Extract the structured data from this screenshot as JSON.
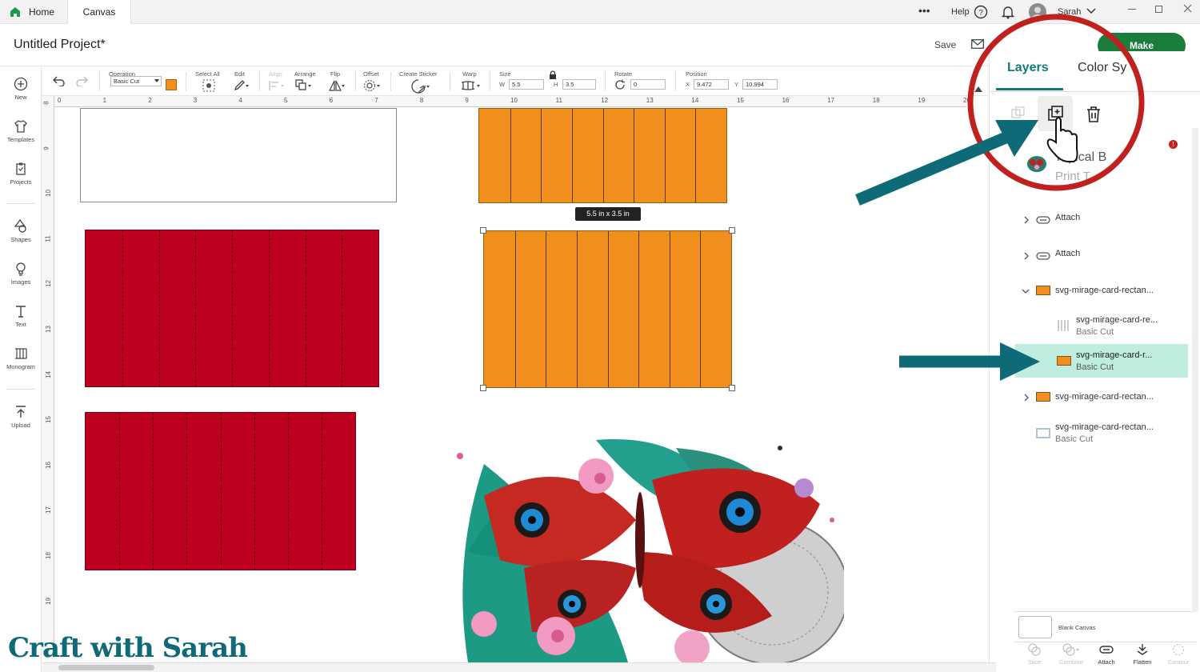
{
  "topnav": {
    "home_label": "Home",
    "canvas_label": "Canvas",
    "more_label": "•••",
    "help_label": "Help",
    "user_name": "Sarah"
  },
  "header": {
    "project_title": "Untitled Project*",
    "save_label": "Save",
    "make_label": "Make"
  },
  "toolbar": {
    "operation_label": "Operation",
    "operation_value": "Basic Cut",
    "select_all_label": "Select All",
    "edit_label": "Edit",
    "align_label": "Align",
    "arrange_label": "Arrange",
    "flip_label": "Flip",
    "offset_label": "Offset",
    "create_sticker_label": "Create Sticker",
    "warp_label": "Warp",
    "size_label": "Size",
    "w_label": "W",
    "w_value": "5.5",
    "h_label": "H",
    "h_value": "3.5",
    "rotate_label": "Rotate",
    "rotate_value": "0",
    "position_label": "Position",
    "x_label": "X",
    "x_value": "9.472",
    "y_label": "Y",
    "y_value": "10.994",
    "operation_color": "#f18f1e"
  },
  "leftbar": {
    "new": "New",
    "templates": "Templates",
    "projects": "Projects",
    "shapes": "Shapes",
    "images": "Images",
    "text": "Text",
    "monogram": "Monogram",
    "upload": "Upload"
  },
  "ruler": {
    "top": [
      "0",
      "1",
      "2",
      "3",
      "4",
      "5",
      "6",
      "7",
      "8",
      "9",
      "10",
      "11",
      "12",
      "13",
      "14",
      "15",
      "16",
      "17",
      "18",
      "19",
      "20"
    ],
    "left": [
      "8",
      "9",
      "10",
      "11",
      "12",
      "13",
      "14",
      "15",
      "16",
      "17",
      "18",
      "19"
    ]
  },
  "canvas": {
    "size_tooltip": "5.5  in x 3.5  in"
  },
  "panel": {
    "tab_layers": "Layers",
    "tab_color_sync": "Color Sy",
    "image_layer_title": "ropical B",
    "image_layer_sub": "Print T",
    "layers": [
      {
        "name": "Attach"
      },
      {
        "name": "Attach"
      },
      {
        "name": "svg-mirage-card-rectan..."
      },
      {
        "name": "svg-mirage-card-re...",
        "sub": "Basic Cut"
      },
      {
        "name": "svg-mirage-card-r...",
        "sub": "Basic Cut"
      },
      {
        "name": "svg-mirage-card-rectan..."
      },
      {
        "name": "svg-mirage-card-rectan...",
        "sub": "Basic Cut"
      }
    ],
    "blank_canvas_label": "Blank Canvas",
    "bottom": {
      "slice": "Slice",
      "combine": "Combine",
      "attach": "Attach",
      "flatten": "Flatten",
      "contour": "Contour"
    }
  },
  "watermark": {
    "text": "Craft with Sarah"
  },
  "colors": {
    "accent_green": "#1b7d3b",
    "layers_tab": "#0f7a78",
    "selected_layer": "#bfeee0",
    "card_red": "#bd0020",
    "card_orange": "#f18f1e",
    "annotation_circle": "#c0201e",
    "annotation_arrow": "#0f6a78"
  }
}
